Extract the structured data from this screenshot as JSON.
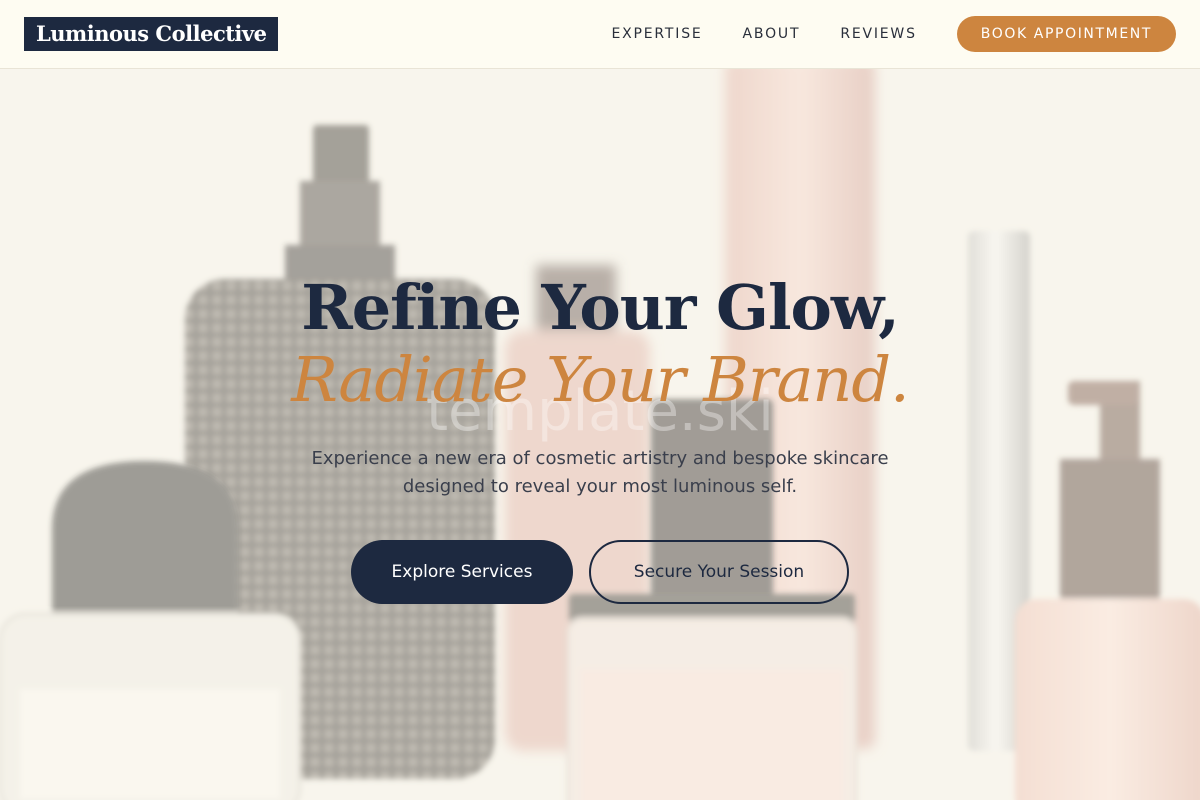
{
  "header": {
    "logo": "Luminous Collective",
    "nav": [
      {
        "label": "EXPERTISE"
      },
      {
        "label": "ABOUT"
      },
      {
        "label": "REVIEWS"
      }
    ],
    "cta": "BOOK APPOINTMENT"
  },
  "hero": {
    "headline_line1": "Refine Your Glow,",
    "headline_line2": "Radiate Your Brand.",
    "subtext_line1": "Experience a new era of cosmetic artistry and bespoke skincare",
    "subtext_line2": "designed to reveal your most luminous self.",
    "primary_button": "Explore Services",
    "secondary_button": "Secure Your Session",
    "watermark": "template.ski"
  },
  "colors": {
    "navy": "#1d2940",
    "accent": "#cd853f",
    "header_bg": "#fefcf2"
  }
}
